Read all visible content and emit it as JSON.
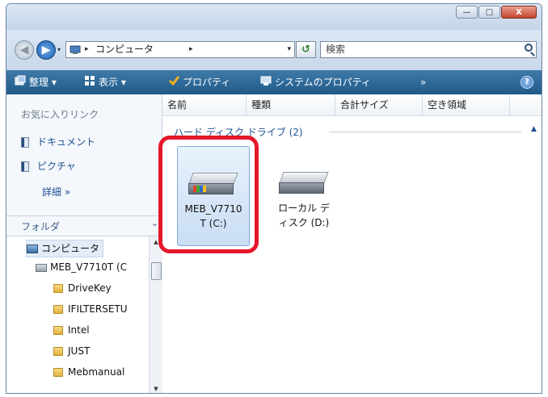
{
  "window": {
    "controls": {
      "minimize": "—",
      "maximize": "□",
      "close": "X"
    }
  },
  "address": {
    "crumb": "コンピュータ",
    "arrow": "▸",
    "dropdown": "▾",
    "search_placeholder": "検索",
    "nav_dropdown": "▾"
  },
  "toolbar": {
    "organize": "整理 ▾",
    "views": "表示 ▾",
    "properties": "プロパティ",
    "system_properties": "システムのプロパティ",
    "more": "»",
    "help": "?"
  },
  "nav": {
    "favorites_header": "お気に入りリンク",
    "favorites": [
      "ドキュメント",
      "ピクチャ"
    ],
    "details": "詳細 »",
    "folders_label": "フォルダ",
    "folders_chevron": "⌄",
    "tree": [
      {
        "label": "コンピュータ",
        "icon": "computer-icon"
      },
      {
        "label": "MEB_V7710T (C",
        "icon": "drive-icon"
      },
      {
        "label": "DriveKey",
        "icon": "folder-icon"
      },
      {
        "label": "IFILTERSETU",
        "icon": "folder-icon"
      },
      {
        "label": "Intel",
        "icon": "folder-icon"
      },
      {
        "label": "JUST",
        "icon": "folder-icon"
      },
      {
        "label": "Mebmanual",
        "icon": "folder-icon"
      }
    ]
  },
  "main": {
    "columns": [
      "名前",
      "種類",
      "合計サイズ",
      "空き領域"
    ],
    "group_header": "ハード ディスク ドライブ (2)",
    "collapse": "▲",
    "drives": [
      {
        "label_line1": "MEB_V7710",
        "label_line2": "T (C:)",
        "icon": "system-drive-icon"
      },
      {
        "label_line1": "ローカル デ",
        "label_line2": "ィスク (D:)",
        "icon": "drive-icon"
      }
    ]
  },
  "colors": {
    "highlight": "#e5172a",
    "toolbar": "#1f5a89",
    "link": "#1d4f91"
  }
}
